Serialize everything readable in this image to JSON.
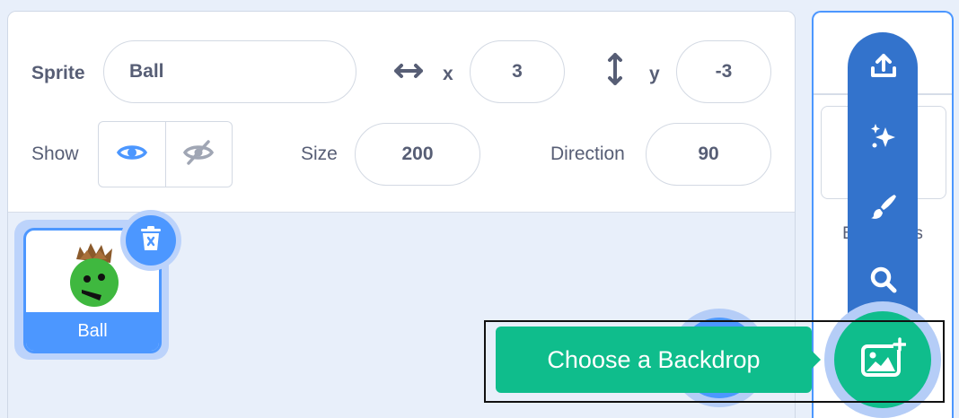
{
  "sprite_info": {
    "sprite_label": "Sprite",
    "sprite_name": "Ball",
    "x_label": "x",
    "x_value": "3",
    "y_label": "y",
    "y_value": "-3",
    "show_label": "Show",
    "size_label": "Size",
    "size_value": "200",
    "direction_label": "Direction",
    "direction_value": "90"
  },
  "sprite_list": [
    {
      "name": "Ball",
      "selected": true
    }
  ],
  "stage": {
    "label": "Backdrops"
  },
  "backdrop_menu": {
    "items": [
      "upload-icon",
      "surprise-icon",
      "paint-icon",
      "search-icon"
    ],
    "tooltip": "Choose a Backdrop"
  },
  "colors": {
    "primary": "#4c97ff",
    "menu": "#3373cc",
    "extension_green": "#0fbd8c",
    "text": "#575e75"
  }
}
